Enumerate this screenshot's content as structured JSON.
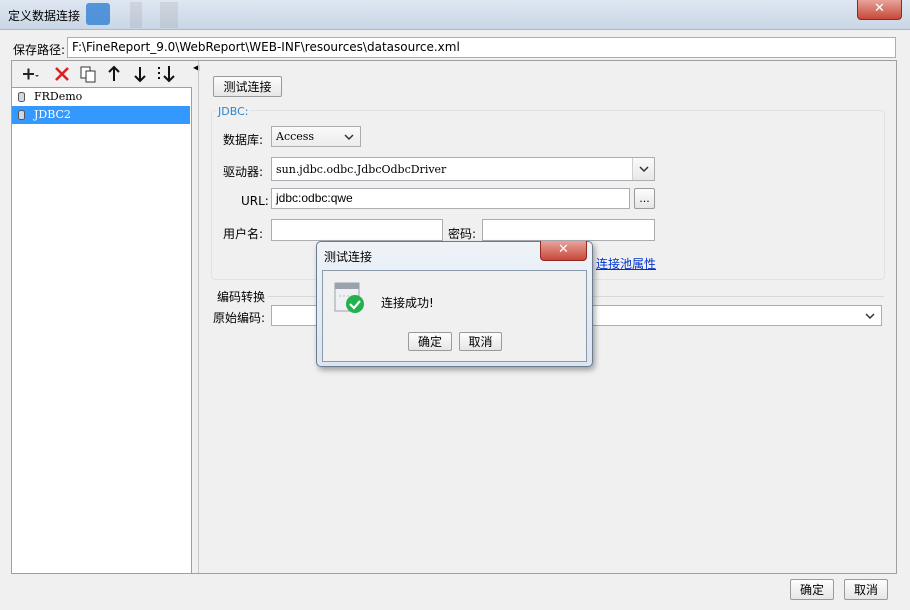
{
  "window": {
    "title": "定义数据连接",
    "close_glyph": "✕"
  },
  "path": {
    "label": "保存路径:",
    "value": "F:\\FineReport_9.0\\WebReport\\WEB-INF\\resources\\datasource.xml"
  },
  "toolbar": {
    "add_icon": "plus-icon",
    "delete_icon": "delete-icon",
    "copy_icon": "copy-icon",
    "up_icon": "arrow-up-icon",
    "down_icon": "arrow-down-icon",
    "sort_icon": "sort-icon"
  },
  "datasources": [
    {
      "name": "FRDemo",
      "selected": false
    },
    {
      "name": "JDBC2",
      "selected": true
    }
  ],
  "test_button": "测试连接",
  "jdbc": {
    "legend": "JDBC:",
    "db_label": "数据库:",
    "db_value": "Access",
    "driver_label": "驱动器:",
    "driver_value": "sun.jdbc.odbc.JdbcOdbcDriver",
    "url_label": "URL:",
    "url_value": "jdbc:odbc:qwe",
    "url_more": "...",
    "user_label": "用户名:",
    "user_value": "",
    "password_label": "密码:",
    "password_value": "",
    "pool_link": "连接池属性"
  },
  "encoding": {
    "legend": "编码转换",
    "label": "原始编码:",
    "value": ""
  },
  "footer": {
    "ok": "确定",
    "cancel": "取消"
  },
  "dialog": {
    "title": "测试连接",
    "close_glyph": "✕",
    "message": "连接成功!",
    "ok": "确定",
    "cancel": "取消",
    "status_color": "#22b14c"
  }
}
